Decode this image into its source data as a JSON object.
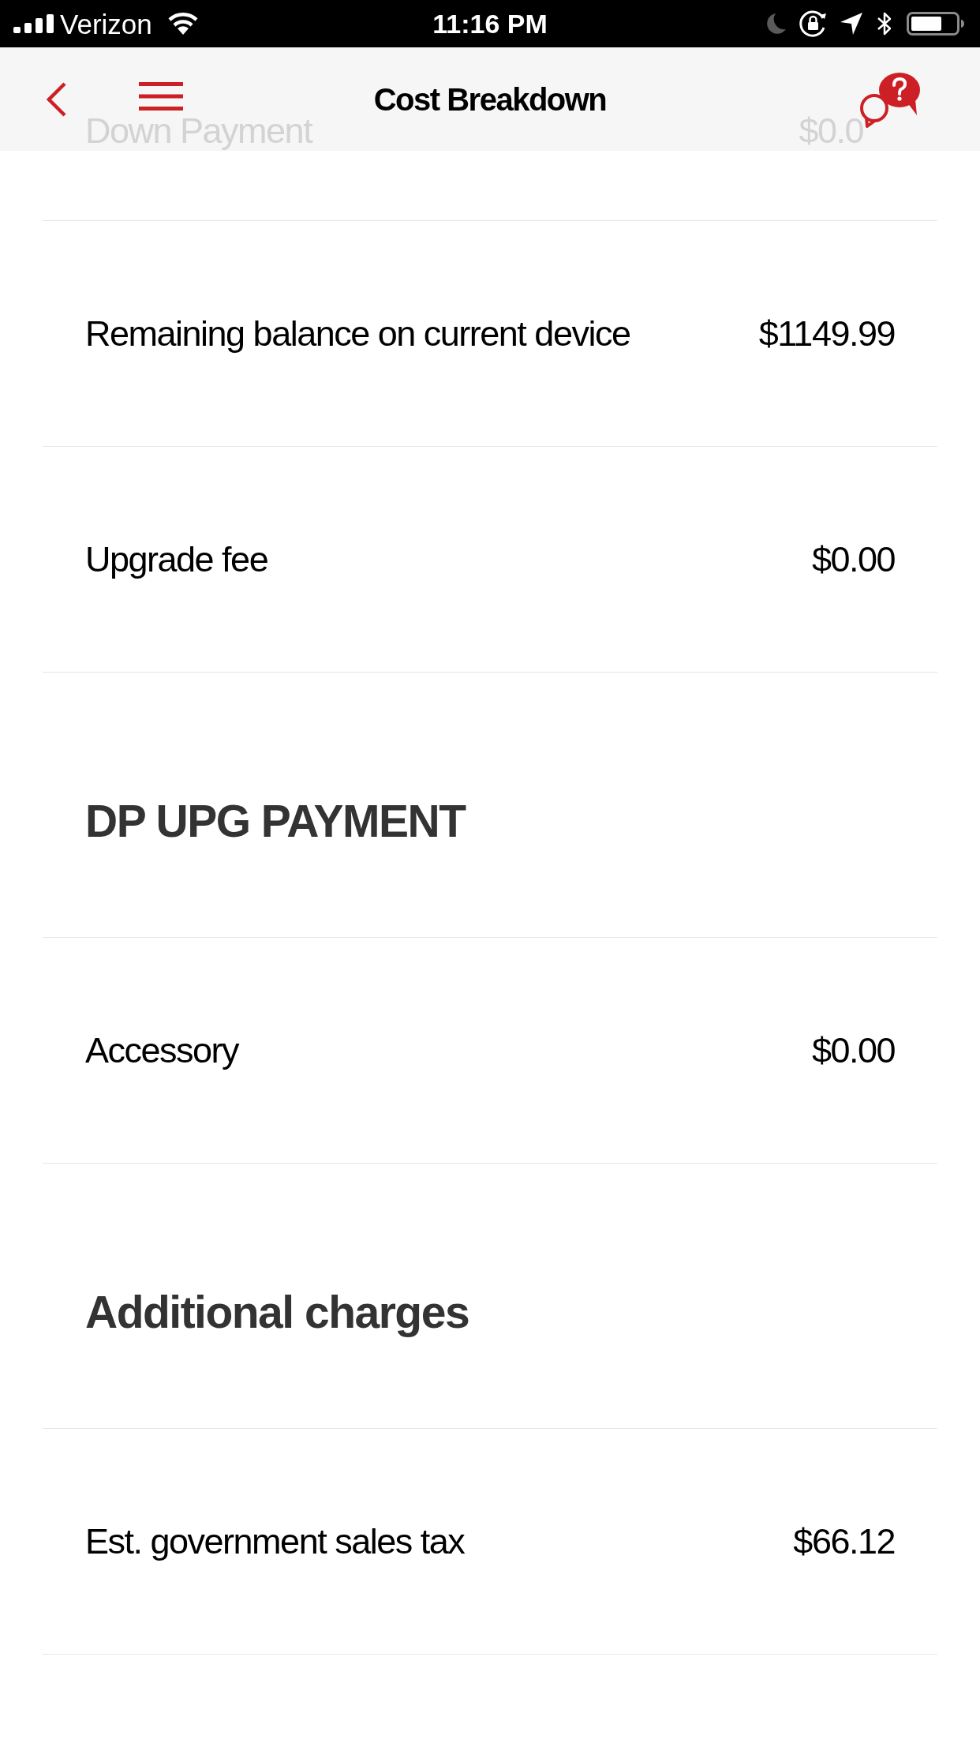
{
  "status_bar": {
    "carrier": "Verizon",
    "time": "11:16 PM"
  },
  "nav_bar": {
    "title": "Cost Breakdown"
  },
  "rows": [
    {
      "kind": "item",
      "label": "Down Payment",
      "amount": "$0.0",
      "under_header": true
    },
    {
      "kind": "item",
      "label": "Remaining balance on current device",
      "amount": "$1149.99",
      "under_header": false
    },
    {
      "kind": "item",
      "label": "Upgrade fee",
      "amount": "$0.00",
      "under_header": false
    },
    {
      "kind": "section",
      "title": "DP UPG PAYMENT"
    },
    {
      "kind": "item",
      "label": "Accessory",
      "amount": "$0.00",
      "under_header": false
    },
    {
      "kind": "section",
      "title": "Additional charges"
    },
    {
      "kind": "item",
      "label": "Est. government sales tax",
      "amount": "$66.12",
      "under_header": false
    }
  ]
}
